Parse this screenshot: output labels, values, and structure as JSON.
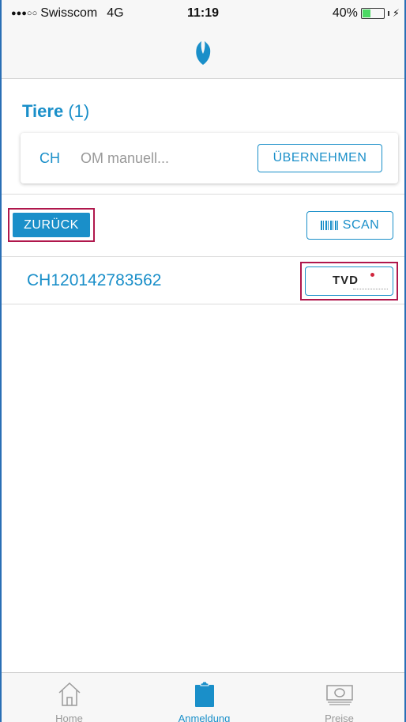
{
  "status_bar": {
    "signal": "●●●○○",
    "carrier": "Swisscom",
    "network": "4G",
    "time": "11:19",
    "battery": "40%",
    "battery_level": 0.4
  },
  "nav": {
    "logo_icon": "flame-logo-icon"
  },
  "section": {
    "title": "Tiere",
    "count": "(1)"
  },
  "om_entry": {
    "prefix": "CH",
    "placeholder": "OM manuell...",
    "apply_label": "ÜBERNEHMEN"
  },
  "actions": {
    "back_label": "ZURÜCK",
    "scan_label": "SCAN"
  },
  "animals": [
    {
      "id": "CH120142783562",
      "tvd_label": "TVD"
    }
  ],
  "tabs": [
    {
      "label": "Home",
      "icon": "home-icon",
      "active": false
    },
    {
      "label": "Anmeldung",
      "icon": "clipboard-icon",
      "active": true
    },
    {
      "label": "Preise",
      "icon": "money-icon",
      "active": false
    }
  ],
  "colors": {
    "accent": "#1a8fc9",
    "highlight": "#b0174c",
    "tvd_dot": "#d0253d"
  }
}
